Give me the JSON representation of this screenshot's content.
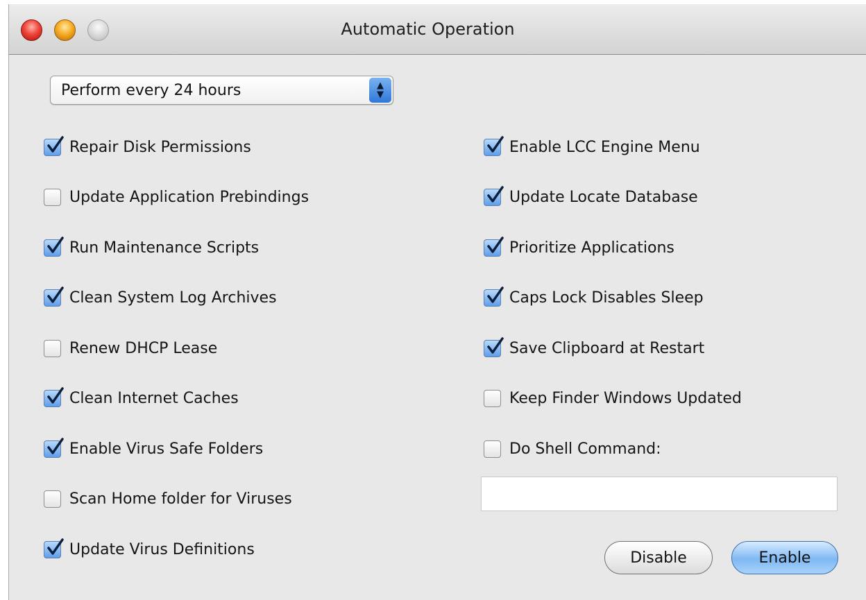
{
  "window": {
    "title": "Automatic Operation"
  },
  "schedule": {
    "selected": "Perform every 24 hours"
  },
  "left_options": [
    {
      "label": "Repair Disk Permissions",
      "checked": true
    },
    {
      "label": "Update Application Prebindings",
      "checked": false
    },
    {
      "label": "Run Maintenance Scripts",
      "checked": true
    },
    {
      "label": "Clean System Log Archives",
      "checked": true
    },
    {
      "label": "Renew DHCP Lease",
      "checked": false
    },
    {
      "label": "Clean Internet Caches",
      "checked": true
    },
    {
      "label": "Enable Virus Safe Folders",
      "checked": true
    },
    {
      "label": "Scan Home folder for Viruses",
      "checked": false
    },
    {
      "label": "Update Virus Definitions",
      "checked": true
    }
  ],
  "right_options": [
    {
      "label": "Enable LCC Engine Menu",
      "checked": true
    },
    {
      "label": "Update Locate Database",
      "checked": true
    },
    {
      "label": "Prioritize Applications",
      "checked": true
    },
    {
      "label": "Caps Lock Disables Sleep",
      "checked": true
    },
    {
      "label": "Save Clipboard at Restart",
      "checked": true
    },
    {
      "label": "Keep Finder Windows Updated",
      "checked": false
    },
    {
      "label": "Do Shell Command:",
      "checked": false
    }
  ],
  "shell_command": {
    "value": ""
  },
  "buttons": {
    "disable": "Disable",
    "enable": "Enable"
  },
  "colors": {
    "accent": "#5e9ee9",
    "checkmark": "#0c1f3d"
  }
}
